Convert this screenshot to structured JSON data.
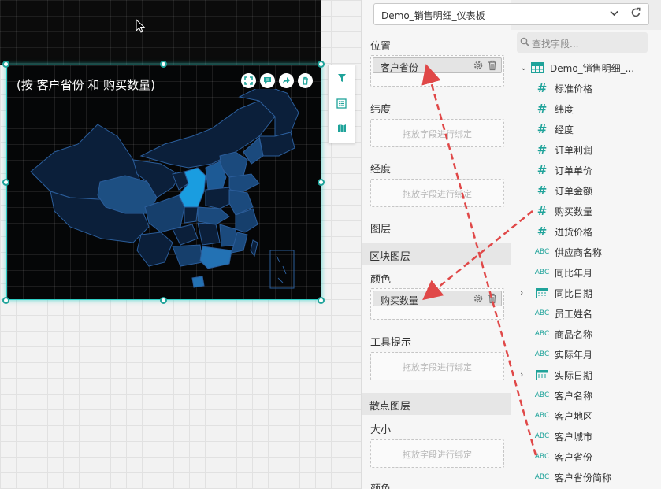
{
  "widget": {
    "title": "(按 客户省份 和 购买数量)"
  },
  "dataset": {
    "selected": "Demo_销售明细_仪表板"
  },
  "sections": {
    "position": "位置",
    "latitude": "纬度",
    "longitude": "经度",
    "layers": "图层",
    "region_layer": "区块图层",
    "color": "颜色",
    "tooltip": "工具提示",
    "scatter_layer": "散点图层",
    "size": "大小",
    "color2": "颜色"
  },
  "bindings": {
    "position_field": "客户省份",
    "color_field": "购买数量",
    "drop_placeholder": "拖放字段进行绑定"
  },
  "field_search": {
    "placeholder": "查找字段..."
  },
  "field_tree": {
    "root": "Demo_销售明细_...",
    "fields": [
      {
        "name": "标准价格",
        "type": "#"
      },
      {
        "name": "纬度",
        "type": "#"
      },
      {
        "name": "经度",
        "type": "#"
      },
      {
        "name": "订单利润",
        "type": "#"
      },
      {
        "name": "订单单价",
        "type": "#"
      },
      {
        "name": "订单金额",
        "type": "#"
      },
      {
        "name": "购买数量",
        "type": "#"
      },
      {
        "name": "进货价格",
        "type": "#"
      },
      {
        "name": "供应商名称",
        "type": "ABC"
      },
      {
        "name": "同比年月",
        "type": "ABC"
      },
      {
        "name": "同比日期",
        "type": "date"
      },
      {
        "name": "员工姓名",
        "type": "ABC"
      },
      {
        "name": "商品名称",
        "type": "ABC"
      },
      {
        "name": "实际年月",
        "type": "ABC"
      },
      {
        "name": "实际日期",
        "type": "date"
      },
      {
        "name": "客户名称",
        "type": "ABC"
      },
      {
        "name": "客户地区",
        "type": "ABC"
      },
      {
        "name": "客户城市",
        "type": "ABC"
      },
      {
        "name": "客户省份",
        "type": "ABC"
      },
      {
        "name": "客户省份简称",
        "type": "ABC"
      }
    ]
  },
  "colors": {
    "accent": "#1fa39a",
    "arrow": "#e04848",
    "map_highlight": "#1a9de0"
  }
}
